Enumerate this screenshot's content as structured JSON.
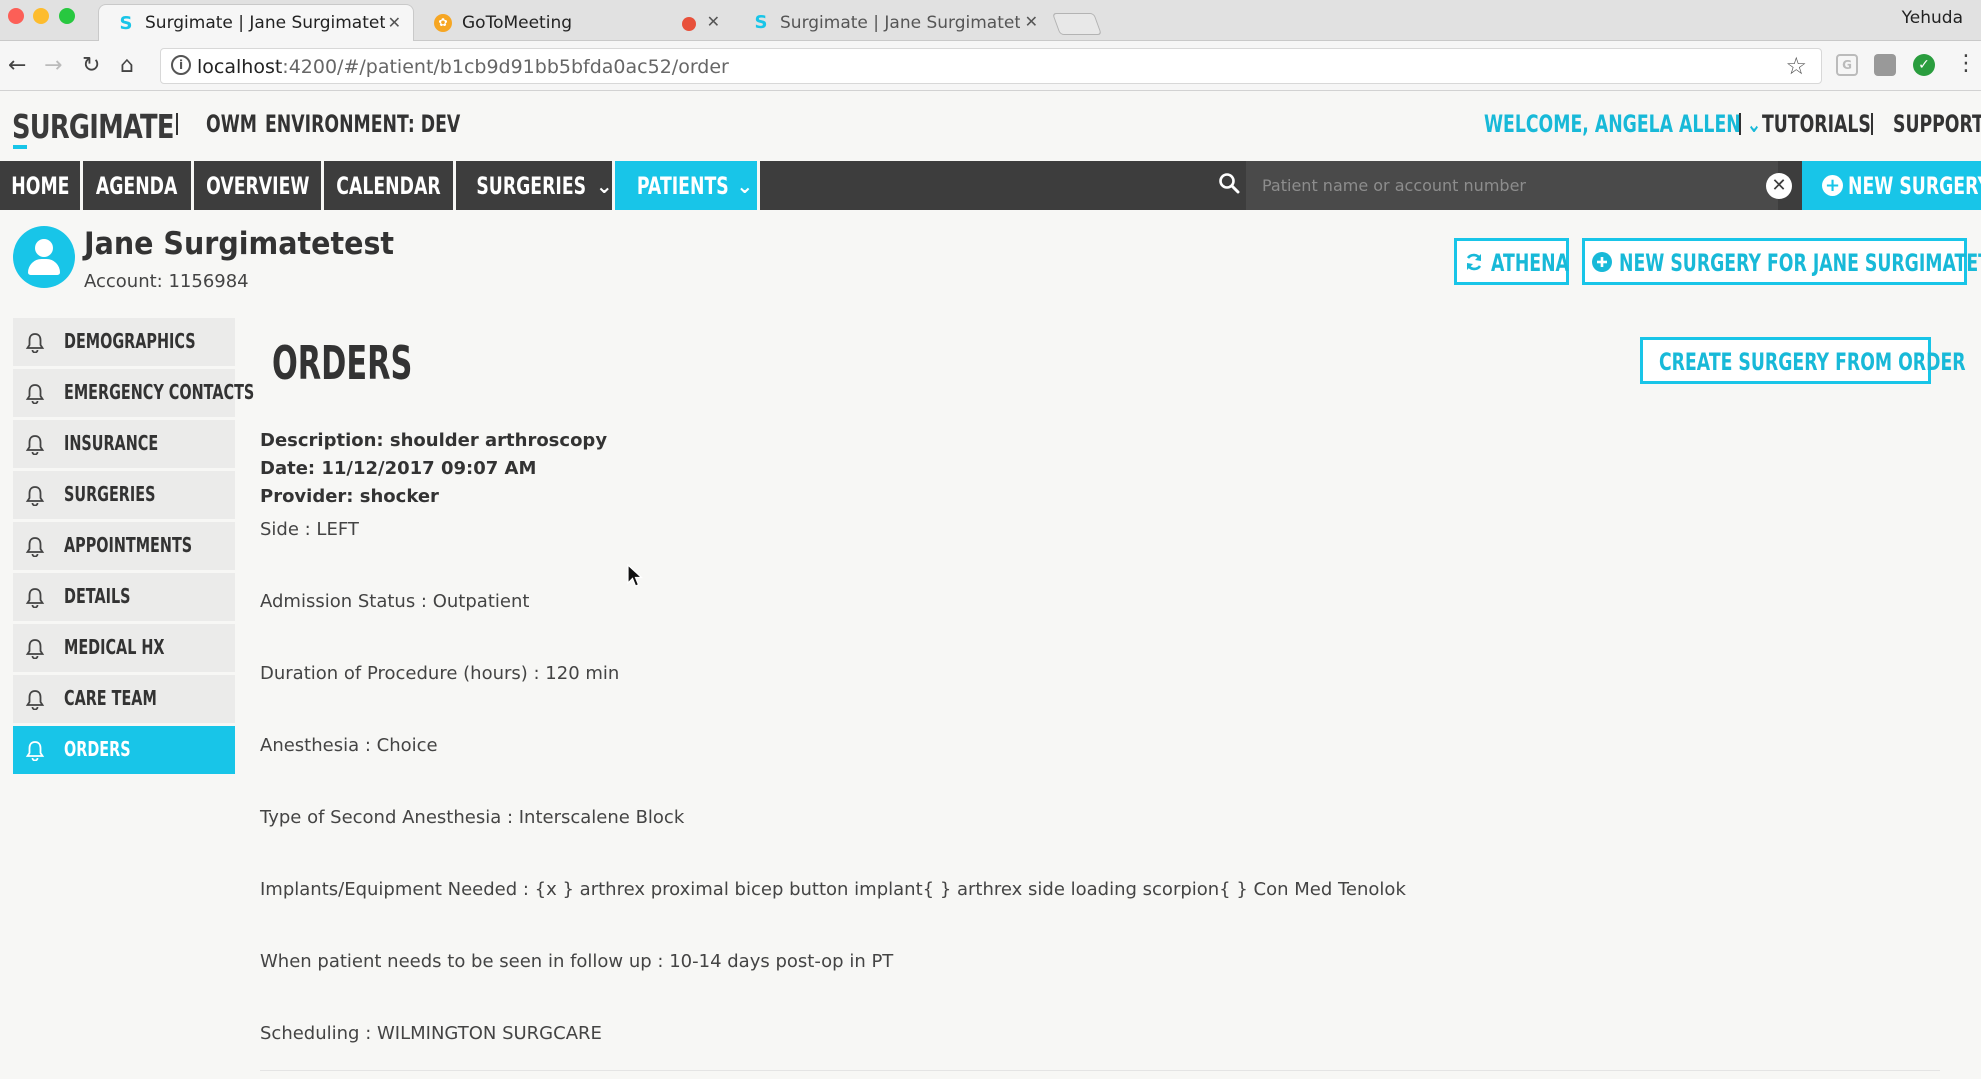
{
  "browser": {
    "tabs": [
      {
        "title": "Surgimate | Jane Surgimatetest",
        "favicon": "S"
      },
      {
        "title": "GoToMeeting",
        "favicon": "gotomeeting-icon"
      },
      {
        "title": "Surgimate | Jane Surgimatetest",
        "favicon": "S"
      }
    ],
    "profile": "Yehuda",
    "url_host": "localhost",
    "url_rest": ":4200/#/patient/b1cb9d91bb5bfda0ac52/order",
    "info_glyph": "i"
  },
  "header": {
    "logo": "SURGIMATE",
    "org": "OWM",
    "environment": "ENVIRONMENT: DEV",
    "welcome": "WELCOME, ANGELA ALLEN",
    "tutorials": "TUTORIALS",
    "support": "SUPPORT",
    "accent_color": "#18c5e8"
  },
  "nav": {
    "items": [
      "HOME",
      "AGENDA",
      "OVERVIEW",
      "CALENDAR",
      "SURGERIES",
      "PATIENTS"
    ],
    "active": "PATIENTS",
    "search_placeholder": "Patient name or account number",
    "new_surgery": "NEW SURGERY"
  },
  "patient": {
    "name": "Jane Surgimatetest",
    "account": "Account: 1156984",
    "athena_button": "ATHENA",
    "new_surgery_for_button": "NEW SURGERY FOR JANE SURGIMATETEST"
  },
  "sidebar": {
    "items": [
      "DEMOGRAPHICS",
      "EMERGENCY CONTACTS",
      "INSURANCE",
      "SURGERIES",
      "APPOINTMENTS",
      "DETAILS",
      "MEDICAL HX",
      "CARE TEAM",
      "ORDERS"
    ],
    "active": "ORDERS"
  },
  "orders": {
    "title": "ORDERS",
    "create_button": "CREATE SURGERY FROM ORDER",
    "description": "Description: shoulder arthroscopy",
    "date": "Date: 11/12/2017 09:07 AM",
    "provider": "Provider: shocker",
    "fields": [
      "Side : LEFT",
      "Admission Status : Outpatient",
      "Duration of Procedure (hours) : 120 min",
      "Anesthesia : Choice",
      "Type of Second Anesthesia : Interscalene Block",
      "Implants/Equipment Needed : {x } arthrex proximal bicep button implant{ } arthrex side loading scorpion{ } Con Med Tenolok",
      "When patient needs to be seen in follow up : 10-14 days post-op in PT",
      "Scheduling : WILMINGTON SURGCARE"
    ]
  }
}
